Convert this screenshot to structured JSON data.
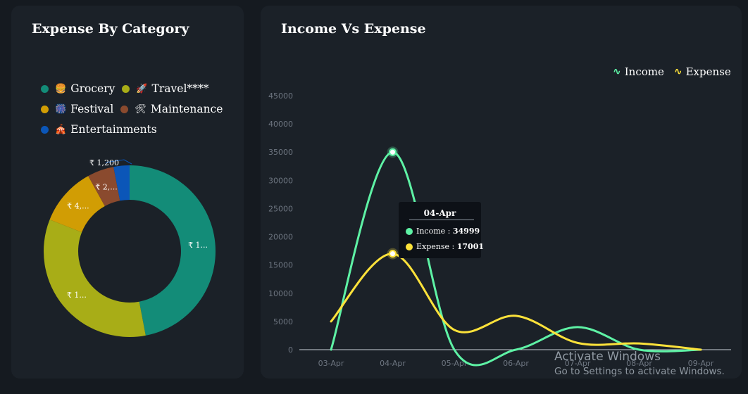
{
  "expense_card": {
    "title": "Expense By Category",
    "legend": [
      {
        "emoji": "🍔",
        "label": "Grocery",
        "color": "#138c78"
      },
      {
        "emoji": "🚀",
        "label": "Travel****",
        "color": "#a8ad17"
      },
      {
        "emoji": "🎆",
        "label": "Festival",
        "color": "#d19d04"
      },
      {
        "emoji": "🛠",
        "label": "Maintenance",
        "color": "#8a4a2e"
      },
      {
        "emoji": "🎪",
        "label": "Entertainments",
        "color": "#0b56b8"
      }
    ]
  },
  "income_card": {
    "title": "Income Vs Expense",
    "legend": [
      {
        "label": "Income",
        "color": "#5ef2a5"
      },
      {
        "label": "Expense",
        "color": "#fde23a"
      }
    ],
    "tooltip": {
      "title": "04-Apr",
      "rows": [
        {
          "label": "Income :",
          "value": "34999",
          "color": "#5ef2a5"
        },
        {
          "label": "Expense :",
          "value": "17001",
          "color": "#fde23a"
        }
      ]
    }
  },
  "chart_data": [
    {
      "type": "pie",
      "variant": "donut",
      "categories": [
        "Grocery",
        "Travel****",
        "Festival",
        "Maintenance",
        "Entertainments"
      ],
      "values": [
        47,
        34,
        11,
        5,
        3
      ],
      "data_labels": [
        "₹ 1...",
        "₹ 1...",
        "₹ 4,...",
        "₹ 2,...",
        "₹ 1,200"
      ],
      "colors": [
        "#138c78",
        "#a8ad17",
        "#d19d04",
        "#8a4a2e",
        "#0b56b8"
      ]
    },
    {
      "type": "line",
      "smooth": true,
      "categories": [
        "03-Apr",
        "04-Apr",
        "05-Apr",
        "06-Apr",
        "07-Apr",
        "08-Apr",
        "09-Apr"
      ],
      "series": [
        {
          "name": "Income",
          "color": "#5ef2a5",
          "values": [
            0,
            34999,
            0,
            0,
            4000,
            0,
            0
          ]
        },
        {
          "name": "Expense",
          "color": "#fde23a",
          "values": [
            5000,
            17001,
            3500,
            6000,
            1200,
            1100,
            0
          ]
        }
      ],
      "ylim": [
        0,
        45000
      ],
      "yticks": [
        0,
        5000,
        10000,
        15000,
        20000,
        25000,
        30000,
        35000,
        40000,
        45000
      ],
      "highlight_category": "04-Apr",
      "legend_position": "top-right",
      "grid": false
    }
  ],
  "watermark": {
    "title": "Activate Windows",
    "subtitle": "Go to Settings to activate Windows."
  }
}
